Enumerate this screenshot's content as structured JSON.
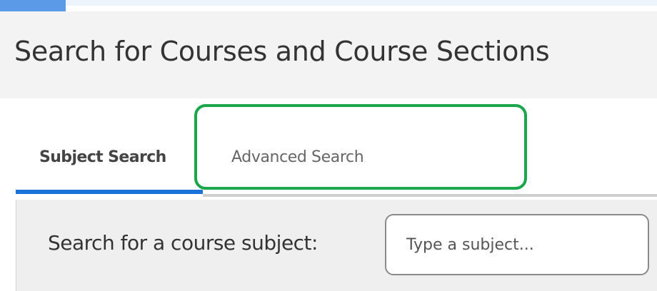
{
  "header": {
    "title": "Search for Courses and Course Sections"
  },
  "tabs": [
    {
      "label": "Subject Search",
      "active": true
    },
    {
      "label": "Advanced Search",
      "active": false
    }
  ],
  "search": {
    "label": "Search for a course subject:",
    "placeholder": "Type a subject...",
    "value": ""
  },
  "colors": {
    "active_tab_underline": "#1b73d9",
    "highlight_outline": "#1aa64a",
    "panel_background": "#efefef"
  }
}
